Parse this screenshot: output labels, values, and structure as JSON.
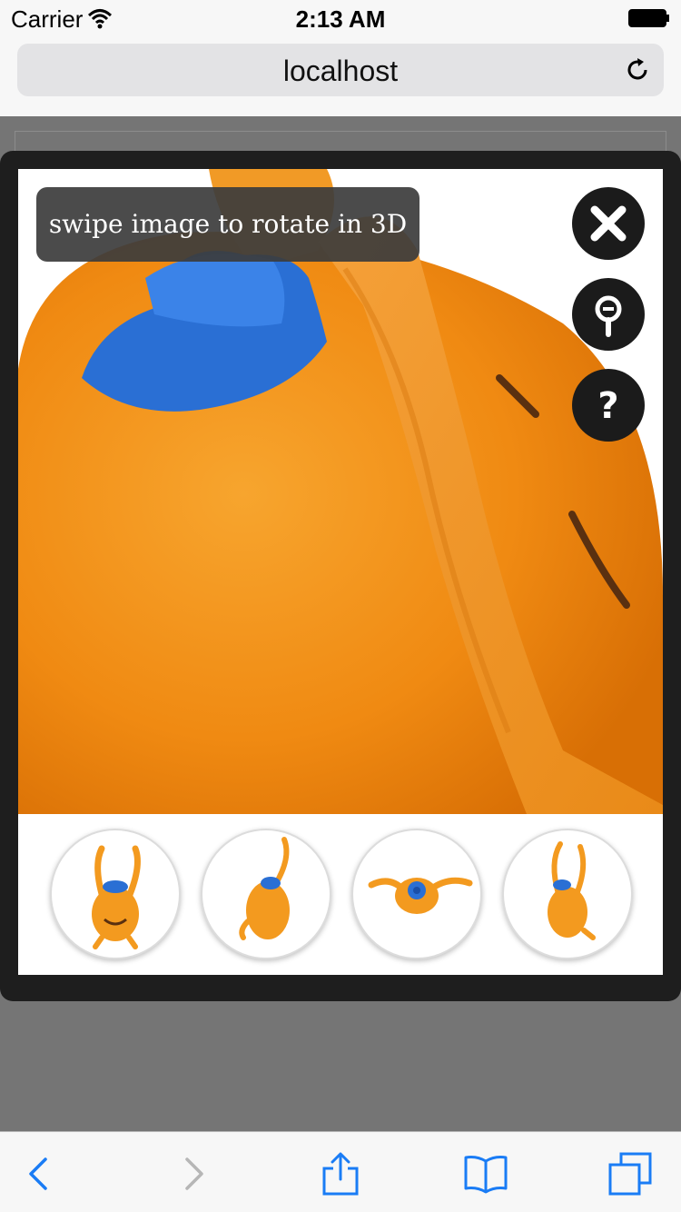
{
  "status": {
    "carrier": "Carrier",
    "time": "2:13 AM"
  },
  "browser": {
    "url": "localhost"
  },
  "viewer": {
    "hint": "swipe image to rotate in 3D"
  },
  "icons": {
    "close": "close-icon",
    "zoom": "zoom-out-icon",
    "help": "help-icon",
    "back": "chevron-left-icon",
    "forward": "chevron-right-icon",
    "share": "share-icon",
    "bookmarks": "bookmarks-icon",
    "tabs": "tabs-icon"
  },
  "colors": {
    "accent": "#1a7cf5",
    "plush": "#f39a1f",
    "hat": "#2a6fd4",
    "overlay": "#1e1e1e"
  },
  "thumbnails": [
    {
      "view": "front"
    },
    {
      "view": "side"
    },
    {
      "view": "top"
    },
    {
      "view": "angled"
    }
  ]
}
